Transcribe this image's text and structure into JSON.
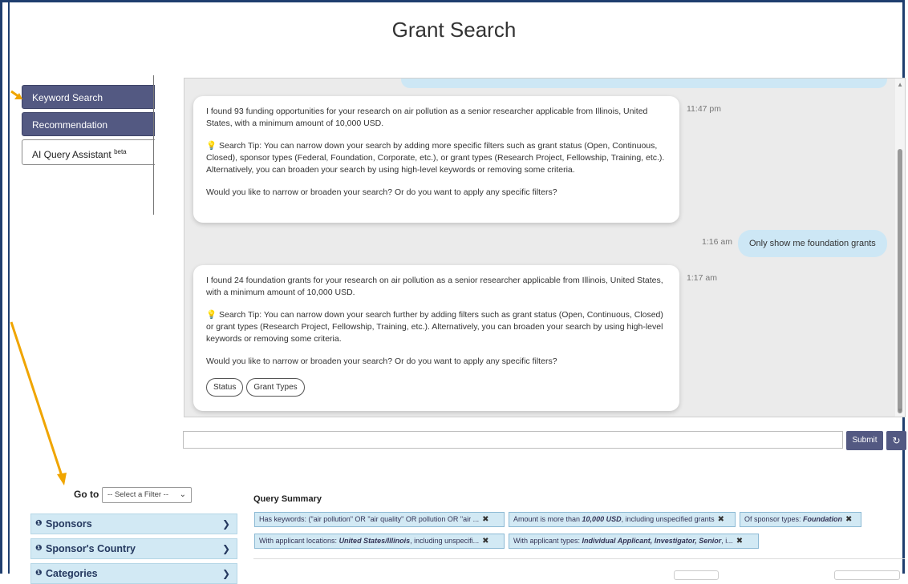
{
  "page": {
    "title": "Grant Search"
  },
  "nav": {
    "tabs": [
      {
        "label": "Keyword Search"
      },
      {
        "label": "Recommendation"
      },
      {
        "label": "AI Query Assistant",
        "badge": "beta"
      }
    ]
  },
  "chat": {
    "messages": [
      {
        "time": "11:47 pm",
        "p1": "I found 93 funding opportunities for your research on air pollution as a senior researcher applicable from Illinois, United States, with a minimum amount of 10,000 USD.",
        "p2": "Search Tip: You can narrow down your search by adding more specific filters such as grant status (Open, Continuous, Closed), sponsor types (Federal, Foundation, Corporate, etc.), or grant types (Research Project, Fellowship, Training, etc.). Alternatively, you can broaden your search by using high-level keywords or removing some criteria.",
        "p3": "Would you like to narrow or broaden your search? Or do you want to apply any specific filters?"
      },
      {
        "time": "1:17 am",
        "p1": "I found 24 foundation grants for your research on air pollution as a senior researcher applicable from Illinois, United States, with a minimum amount of 10,000 USD.",
        "p2": "Search Tip: You can narrow down your search further by adding filters such as grant status (Open, Continuous, Closed) or grant types (Research Project, Fellowship, Training, etc.). Alternatively, you can broaden your search by using high-level keywords or removing some criteria.",
        "p3": "Would you like to narrow or broaden your search? Or do you want to apply any specific filters?",
        "chips": [
          "Status",
          "Grant Types"
        ]
      }
    ],
    "user_message": {
      "time": "1:16 am",
      "text": "Only show me foundation grants"
    },
    "input_value": "",
    "submit_label": "Submit",
    "reset_icon": "refresh-icon"
  },
  "filters": {
    "goto_label": "Go to",
    "goto_select": "-- Select a Filter --",
    "sections": [
      "Sponsors",
      "Sponsor's Country",
      "Categories"
    ]
  },
  "query_summary": {
    "title": "Query Summary",
    "tags": [
      {
        "pre": "Has keywords: (\"air pollution\" OR \"air quality\" OR pollution OR \"air ...",
        "bold": "",
        "post": ""
      },
      {
        "pre": "Amount is more than ",
        "bold": "10,000 USD",
        "post": ", including unspecified grants"
      },
      {
        "pre": "Of sponsor types: ",
        "bold": "Foundation",
        "post": ""
      },
      {
        "pre": "With applicant locations: ",
        "bold": "United States/Illinois",
        "post": ", including unspecifi..."
      },
      {
        "pre": "With applicant types: ",
        "bold": "Individual Applicant, Investigator, Senior",
        "post": ", i..."
      }
    ]
  },
  "colors": {
    "accent": "#535982",
    "tag_bg": "#d2e9f4",
    "arrow": "#f0a500",
    "frame": "#1f3e6e"
  }
}
